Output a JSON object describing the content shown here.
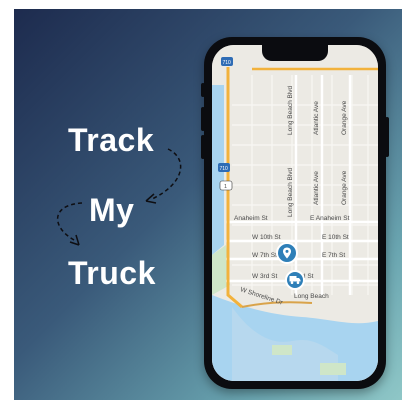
{
  "headline": {
    "line1": "Track",
    "line2": "My",
    "line3": "Truck"
  },
  "map": {
    "streets_horizontal": [
      "Anaheim St",
      "E Anaheim St",
      "W 10th St",
      "E 10th St",
      "W 7th St",
      "E 7th St",
      "W 3rd St",
      "E 3rd St",
      "W Shoreline Dr",
      "Long Beach"
    ],
    "streets_vertical": [
      "Long Beach Blvd",
      "Atlantic Ave",
      "Orange Ave",
      "Long Beach Blvd",
      "Atlantic Ave",
      "Orange Ave"
    ],
    "highway_shields": [
      "710",
      "1",
      "710"
    ],
    "pins": [
      "location-pin-icon",
      "truck-icon"
    ]
  },
  "colors": {
    "accent": "#2e7fb8",
    "water": "#a8d4f0",
    "park": "#cfe6c8",
    "highway": "#f2b23c"
  }
}
